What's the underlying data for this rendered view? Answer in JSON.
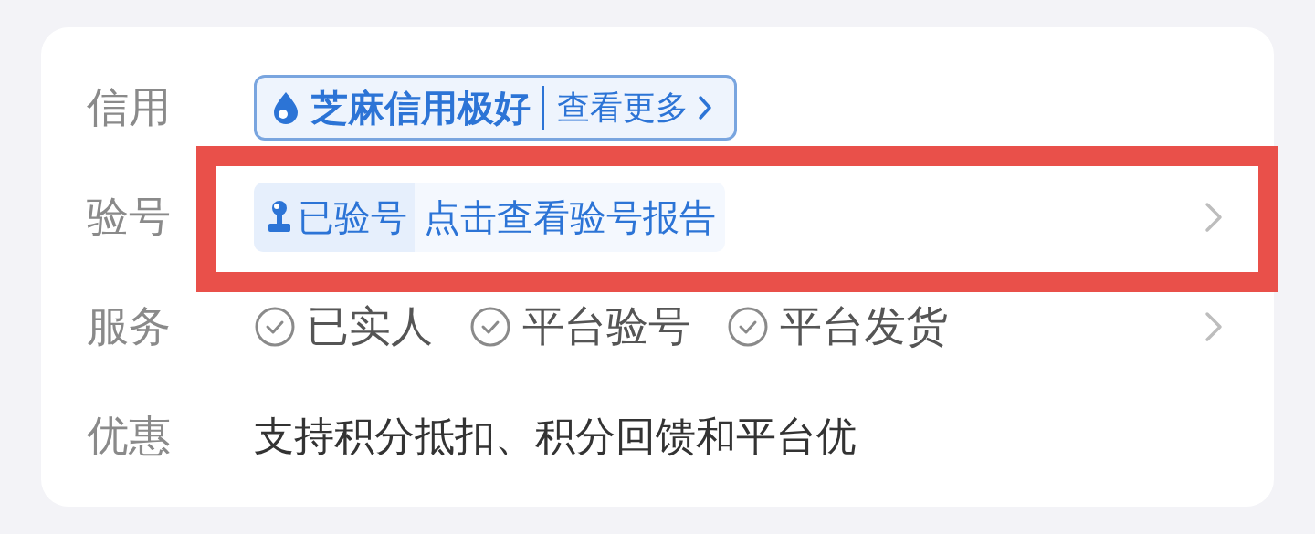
{
  "rows": [
    {
      "kind": "credit",
      "label": "信用",
      "highlighted": false,
      "chevron": false,
      "credit": {
        "rating": "芝麻信用极好",
        "link": "查看更多"
      }
    },
    {
      "kind": "verify",
      "label": "验号",
      "highlighted": true,
      "chevron": true,
      "verify": {
        "tag": "已验号",
        "link": "点击查看验号报告"
      }
    },
    {
      "kind": "services",
      "label": "服务",
      "highlighted": false,
      "chevron": true,
      "services": [
        "已实人",
        "平台验号",
        "平台发货"
      ]
    },
    {
      "kind": "promo",
      "label": "优惠",
      "highlighted": false,
      "chevron": false,
      "text": "支持积分抵扣、积分回馈和平台优"
    }
  ]
}
